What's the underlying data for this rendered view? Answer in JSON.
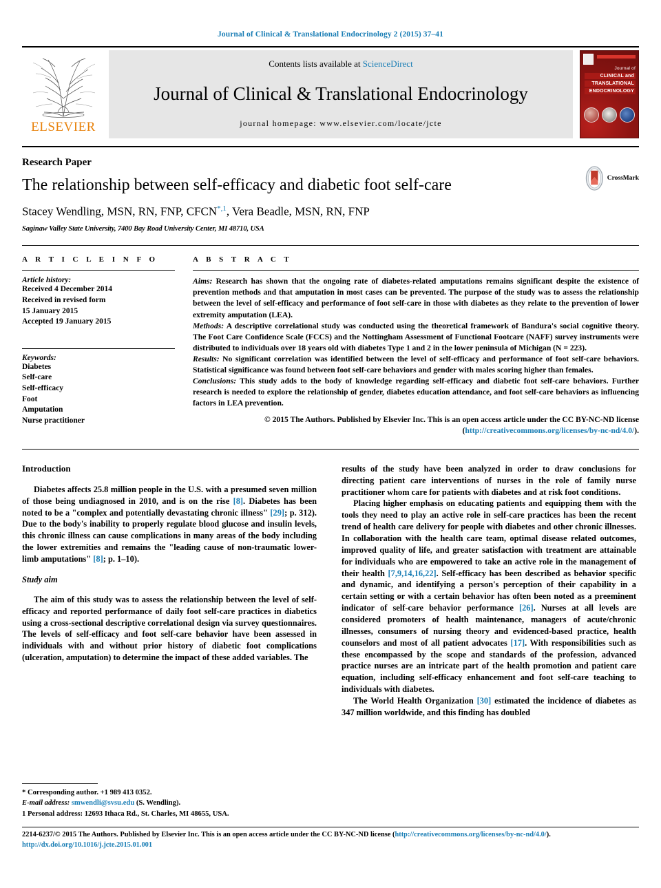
{
  "running_head": "Journal of Clinical & Translational Endocrinology 2 (2015) 37–41",
  "masthead": {
    "publisher": "ELSEVIER",
    "contents_prefix": "Contents lists available at",
    "contents_link": "ScienceDirect",
    "journal_title": "Journal of Clinical & Translational Endocrinology",
    "homepage": "journal homepage: www.elsevier.com/locate/jcte",
    "cover": {
      "line1": "Journal of",
      "line2": "CLINICAL and",
      "line3": "TRANSLATIONAL",
      "line4": "ENDOCRINOLOGY"
    }
  },
  "article": {
    "kind": "Research Paper",
    "title": "The relationship between self-efficacy and diabetic foot self-care",
    "authors": "Stacey Wendling, MSN, RN, FNP, CFCN",
    "author_marks": "*,1",
    "authors_rest": ", Vera Beadle, MSN, RN, FNP",
    "affiliation": "Saginaw Valley State University, 7400 Bay Road University Center, MI 48710, USA",
    "crossmark_label": "CrossMark"
  },
  "article_info": {
    "heading": "A R T I C L E   I N F O",
    "history_label": "Article history:",
    "history": [
      "Received 4 December 2014",
      "Received in revised form",
      "15 January 2015",
      "Accepted 19 January 2015"
    ],
    "keywords_label": "Keywords:",
    "keywords": [
      "Diabetes",
      "Self-care",
      "Self-efficacy",
      "Foot",
      "Amputation",
      "Nurse practitioner"
    ]
  },
  "abstract": {
    "heading": "A B S T R A C T",
    "aims_label": "Aims:",
    "aims": " Research has shown that the ongoing rate of diabetes-related amputations remains significant despite the existence of prevention methods and that amputation in most cases can be prevented. The purpose of the study was to assess the relationship between the level of self-efficacy and performance of foot self-care in those with diabetes as they relate to the prevention of lower extremity amputation (LEA).",
    "methods_label": "Methods:",
    "methods": " A descriptive correlational study was conducted using the theoretical framework of Bandura's social cognitive theory. The Foot Care Confidence Scale (FCCS) and the Nottingham Assessment of Functional Footcare (NAFF) survey instruments were distributed to individuals over 18 years old with diabetes Type 1 and 2 in the lower peninsula of Michigan (N = 223).",
    "results_label": "Results:",
    "results": " No significant correlation was identified between the level of self-efficacy and performance of foot self-care behaviors. Statistical significance was found between foot self-care behaviors and gender with males scoring higher than females.",
    "conclusions_label": "Conclusions:",
    "conclusions": " This study adds to the body of knowledge regarding self-efficacy and diabetic foot self-care behaviors. Further research is needed to explore the relationship of gender, diabetes education attendance, and foot self-care behaviors as influencing factors in LEA prevention.",
    "copyright_text": "© 2015 The Authors. Published by Elsevier Inc. This is an open access article under the CC BY-NC-ND license (",
    "copyright_link": "http://creativecommons.org/licenses/by-nc-nd/4.0/",
    "copyright_tail": ")."
  },
  "body": {
    "intro_heading": "Introduction",
    "intro_p1_a": "Diabetes affects 25.8 million people in the U.S. with a presumed seven million of those being undiagnosed in 2010, and is on the rise ",
    "intro_ref1": "[8]",
    "intro_p1_b": ". Diabetes has been noted to be a \"complex and potentially devastating chronic illness\" ",
    "intro_ref2": "[29]",
    "intro_p1_c": "; p. 312). Due to the body's inability to properly regulate blood glucose and insulin levels, this chronic illness can cause complications in many areas of the body including the lower extremities and remains the \"leading cause of non-traumatic lower-limb amputations\" ",
    "intro_ref3": "[8]",
    "intro_p1_d": "; p. 1–10).",
    "studyaim_heading": "Study aim",
    "studyaim_p1": "The aim of this study was to assess the relationship between the level of self-efficacy and reported performance of daily foot self-care practices in diabetics using a cross-sectional descriptive correlational design via survey questionnaires. The levels of self-efficacy and foot self-care behavior have been assessed in individuals with and without prior history of diabetic foot complications (ulceration, amputation) to determine the impact of these added variables. The",
    "right_p1": "results of the study have been analyzed in order to draw conclusions for directing patient care interventions of nurses in the role of family nurse practitioner whom care for patients with diabetes and at risk foot conditions.",
    "right_p2_a": "Placing higher emphasis on educating patients and equipping them with the tools they need to play an active role in self-care practices has been the recent trend of health care delivery for people with diabetes and other chronic illnesses. In collaboration with the health care team, optimal disease related outcomes, improved quality of life, and greater satisfaction with treatment are attainable for individuals who are empowered to take an active role in the management of their health ",
    "right_ref1": "[7,9,14,16,22]",
    "right_p2_b": ". Self-efficacy has been described as behavior specific and dynamic, and identifying a person's perception of their capability in a certain setting or with a certain behavior has often been noted as a preeminent indicator of self-care behavior performance ",
    "right_ref2": "[26]",
    "right_p2_c": ". Nurses at all levels are considered promoters of health maintenance, managers of acute/chronic illnesses, consumers of nursing theory and evidenced-based practice, health counselors and most of all patient advocates ",
    "right_ref3": "[17]",
    "right_p2_d": ". With responsibilities such as these encompassed by the scope and standards of the profession, advanced practice nurses are an intricate part of the health promotion and patient care equation, including self-efficacy enhancement and foot self-care teaching to individuals with diabetes.",
    "right_p3_a": "The World Health Organization ",
    "right_ref4": "[30]",
    "right_p3_b": " estimated the incidence of diabetes as 347 million worldwide, and this finding has doubled"
  },
  "footnotes": {
    "corresponding": "* Corresponding author. +1 989 413 0352.",
    "email_label": "E-mail address:",
    "email": "smwendli@svsu.edu",
    "email_tail": " (S. Wendling).",
    "personal": "1  Personal address: 12693 Ithaca Rd., St. Charles, MI 48655, USA."
  },
  "bottom": {
    "issn_text": "2214-6237/© 2015 The Authors. Published by Elsevier Inc. This is an open access article under the CC BY-NC-ND license (",
    "license_link": "http://creativecommons.org/licenses/by-nc-nd/4.0/",
    "issn_tail": ").",
    "doi": "http://dx.doi.org/10.1016/j.jcte.2015.01.001"
  },
  "colors": {
    "link": "#1a7eb5",
    "elsevier_orange": "#E8820C",
    "cover_red": "#8e1412"
  }
}
